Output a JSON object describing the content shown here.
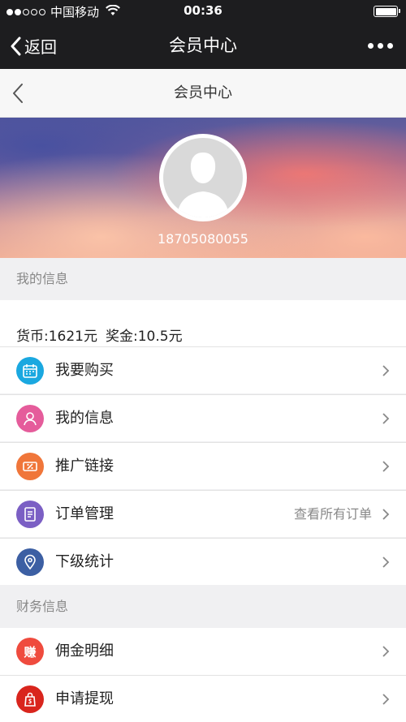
{
  "status_bar": {
    "carrier": "中国移动",
    "time": "00:36"
  },
  "nav": {
    "back_label": "返回",
    "title": "会员中心"
  },
  "sub_header": {
    "title": "会员中心"
  },
  "profile": {
    "phone": "18705080055"
  },
  "my_info": {
    "section_title": "我的信息",
    "currency": "货币:1621元",
    "bonus": "奖金:10.5元",
    "items": [
      {
        "label": "我要购买",
        "icon": "calendar-icon",
        "color": "#1aa8e0"
      },
      {
        "label": "我的信息",
        "icon": "user-icon",
        "color": "#e55c9b"
      },
      {
        "label": "推广链接",
        "icon": "coupon-icon",
        "color": "#f0763a"
      },
      {
        "label": "订单管理",
        "icon": "document-icon",
        "color": "#7b5fc4",
        "extra": "查看所有订单"
      },
      {
        "label": "下级统计",
        "icon": "location-pin-icon",
        "color": "#3c5fa3"
      }
    ]
  },
  "finance": {
    "section_title": "财务信息",
    "items": [
      {
        "label": "佣金明细",
        "icon": "earn-icon",
        "icon_text": "赚",
        "color": "#ef4b3e"
      },
      {
        "label": "申请提现",
        "icon": "wallet-icon",
        "color": "#d9251d"
      }
    ]
  },
  "colors": {
    "topbar": "#1d1d1f",
    "section_bg": "#f0f0f2",
    "divider": "#e3e3e3"
  }
}
